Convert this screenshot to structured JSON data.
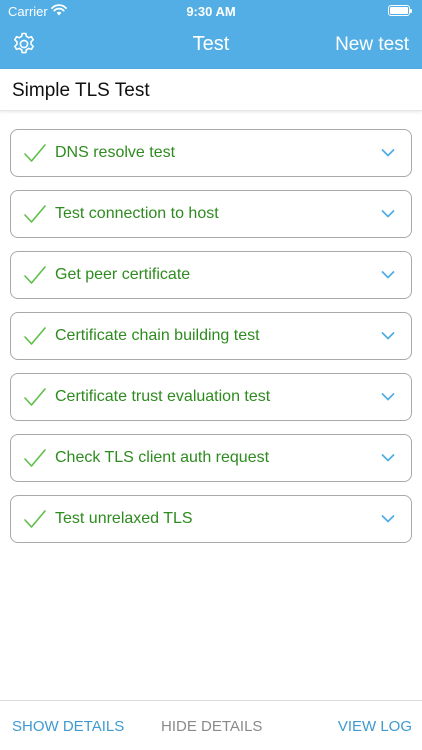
{
  "status_bar": {
    "carrier": "Carrier",
    "time": "9:30 AM"
  },
  "nav": {
    "title": "Test",
    "right_button": "New test",
    "left_icon": "gear-icon"
  },
  "section": {
    "title": "Simple TLS Test"
  },
  "tests": [
    {
      "label": "DNS resolve test",
      "status": "passed"
    },
    {
      "label": "Test connection to host",
      "status": "passed"
    },
    {
      "label": "Get peer certificate",
      "status": "passed"
    },
    {
      "label": "Certificate chain building test",
      "status": "passed"
    },
    {
      "label": "Certificate trust evaluation test",
      "status": "passed"
    },
    {
      "label": "Check TLS client auth request",
      "status": "passed"
    },
    {
      "label": "Test unrelaxed TLS",
      "status": "passed"
    }
  ],
  "bottom_bar": {
    "show_details": "SHOW DETAILS",
    "hide_details": "HIDE DETAILS",
    "view_log": "VIEW LOG"
  },
  "colors": {
    "nav_blue": "#52aee4",
    "pass_green": "#2e8b1f",
    "link_blue": "#3f9ad1",
    "disabled_gray": "#8a8a8a"
  }
}
